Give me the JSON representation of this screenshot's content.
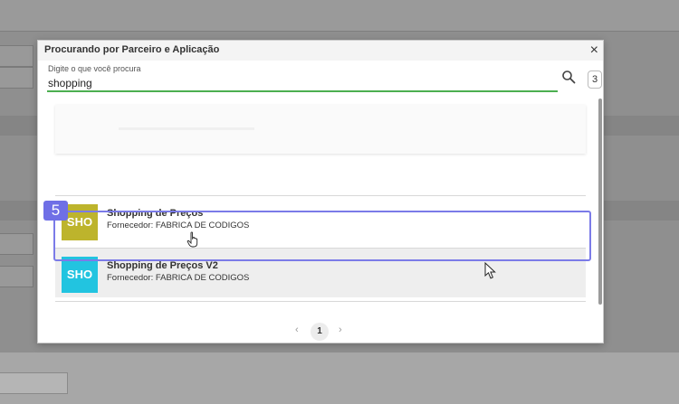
{
  "dialog": {
    "title": "Procurando por Parceiro e Aplicação",
    "close_label": "×",
    "search_label": "Digite o que você procura",
    "search_value": "shopping",
    "result_count": "3",
    "icons": {
      "search": "search-icon",
      "close": "close-icon"
    }
  },
  "results": [
    {
      "thumb_text": "SHO",
      "thumb_color": "#bdb42c",
      "title": "Shopping de Preços",
      "subtitle": "Fornecedor: FABRICA DE CODIGOS"
    },
    {
      "thumb_text": "SHO",
      "thumb_color": "#22c4e0",
      "title": "Shopping de Preços V2",
      "subtitle": "Fornecedor: FABRICA DE CODIGOS"
    }
  ],
  "pagination": {
    "prev": "‹",
    "page": "1",
    "next": "›"
  },
  "annotation": {
    "step": "5",
    "color": "#7b7be8"
  }
}
